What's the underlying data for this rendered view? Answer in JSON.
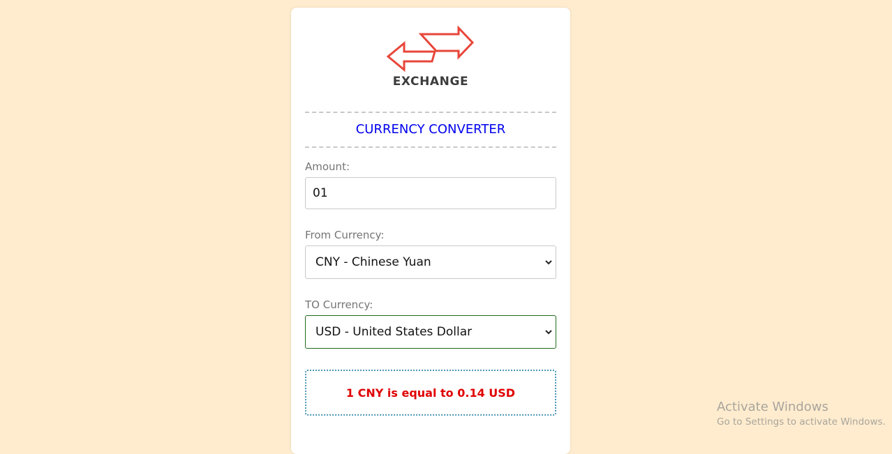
{
  "logo": {
    "text": "EXCHANGE",
    "icon": "exchange-arrows-icon",
    "color": "#e8463a"
  },
  "title": "CURRENCY CONVERTER",
  "amount": {
    "label": "Amount:",
    "value": "01"
  },
  "from_currency": {
    "label": "From Currency:",
    "selected": "CNY - Chinese Yuan"
  },
  "to_currency": {
    "label": "TO Currency:",
    "selected": "USD - United States Dollar"
  },
  "result": {
    "text": "1 CNY is equal to 0.14 USD",
    "color": "#e00000"
  },
  "watermark": {
    "title": "Activate Windows",
    "subtitle": "Go to Settings to activate Windows."
  },
  "colors": {
    "background": "#ffecce",
    "title": "#0000ee",
    "to_select_border": "#1e6b1e"
  }
}
